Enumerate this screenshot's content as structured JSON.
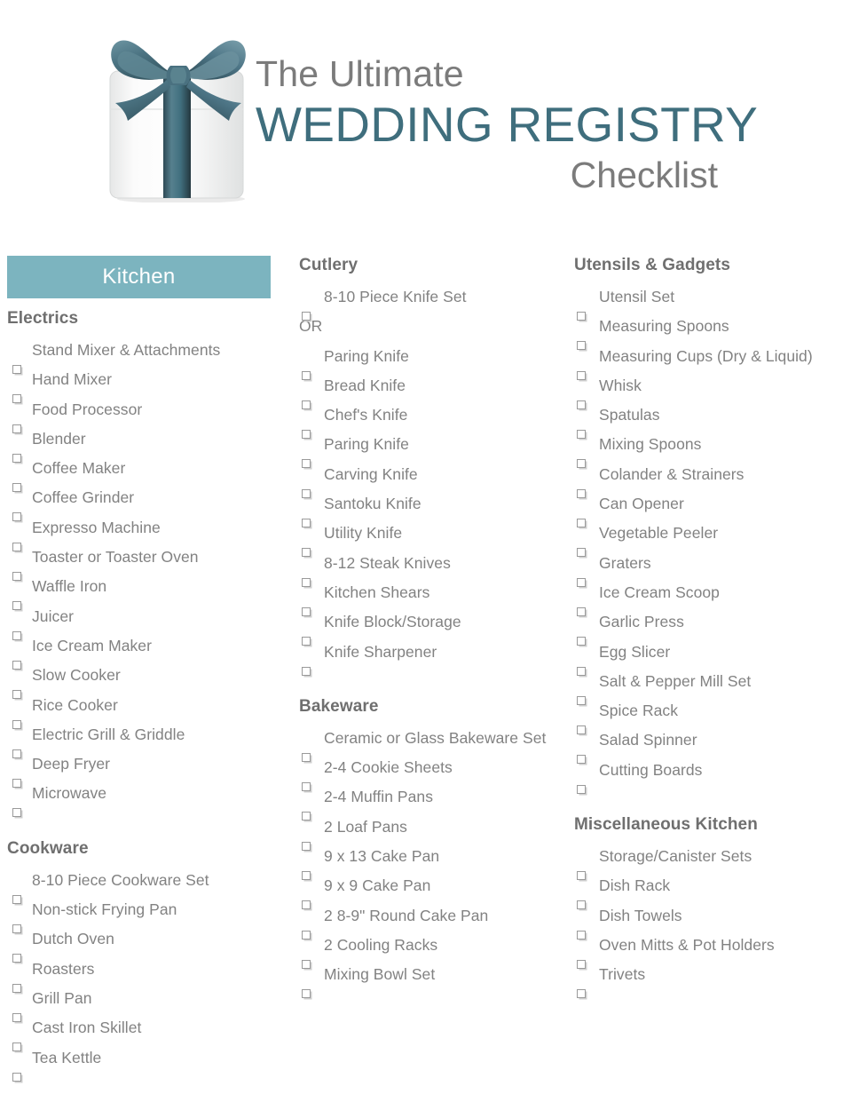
{
  "header": {
    "title_line1": "The Ultimate",
    "title_line2": "WEDDING REGISTRY",
    "title_line3": "Checklist",
    "logo_icon": "gift-box-icon",
    "accent_color": "#3f6e7d",
    "banner_color": "#7cb4bf",
    "text_color": "#7b7b7b"
  },
  "banner": {
    "label": "Kitchen"
  },
  "columns": [
    {
      "id": "column-1",
      "sections": [
        {
          "title": "Electrics",
          "items": [
            "Stand Mixer & Attachments",
            "Hand Mixer",
            "Food Processor",
            "Blender",
            "Coffee Maker",
            "Coffee Grinder",
            "Expresso Machine",
            "Toaster or Toaster Oven",
            "Waffle Iron",
            "Juicer",
            "Ice Cream Maker",
            "Slow Cooker",
            "Rice Cooker",
            "Electric Grill & Griddle",
            "Deep Fryer",
            "Microwave"
          ]
        },
        {
          "title": "Cookware",
          "items": [
            "8-10 Piece Cookware Set",
            "Non-stick Frying Pan",
            "Dutch Oven",
            "Roasters",
            "Grill Pan",
            "Cast Iron Skillet",
            "Tea Kettle"
          ]
        }
      ]
    },
    {
      "id": "column-2",
      "sections": [
        {
          "title": "Cutlery",
          "items": [
            "8-10 Piece Knife Set",
            "OR",
            "Paring Knife",
            "Bread Knife",
            "Chef's Knife",
            "Paring Knife",
            "Carving Knife",
            "Santoku Knife",
            "Utility Knife",
            "8-12 Steak Knives",
            "Kitchen Shears",
            "Knife Block/Storage",
            "Knife Sharpener"
          ],
          "no_checkbox": [
            "OR"
          ]
        },
        {
          "title": "Bakeware",
          "items": [
            "Ceramic or Glass Bakeware Set",
            "2-4 Cookie Sheets",
            "2-4 Muffin Pans",
            "2 Loaf Pans",
            "9 x 13 Cake Pan",
            "9 x 9 Cake Pan",
            "2 8-9\" Round Cake Pan",
            "2 Cooling Racks",
            "Mixing Bowl Set"
          ]
        }
      ]
    },
    {
      "id": "column-3",
      "sections": [
        {
          "title": "Utensils & Gadgets",
          "items": [
            "Utensil Set",
            "Measuring Spoons",
            "Measuring Cups (Dry & Liquid)",
            "Whisk",
            "Spatulas",
            "Mixing Spoons",
            "Colander & Strainers",
            "Can Opener",
            "Vegetable Peeler",
            "Graters",
            "Ice Cream Scoop",
            "Garlic Press",
            "Egg Slicer",
            "Salt & Pepper Mill Set",
            "Spice Rack",
            "Salad Spinner",
            "Cutting Boards"
          ]
        },
        {
          "title": "Miscellaneous Kitchen",
          "items": [
            "Storage/Canister Sets",
            "Dish Rack",
            "Dish Towels",
            "Oven Mitts & Pot Holders",
            "Trivets"
          ]
        }
      ]
    }
  ]
}
